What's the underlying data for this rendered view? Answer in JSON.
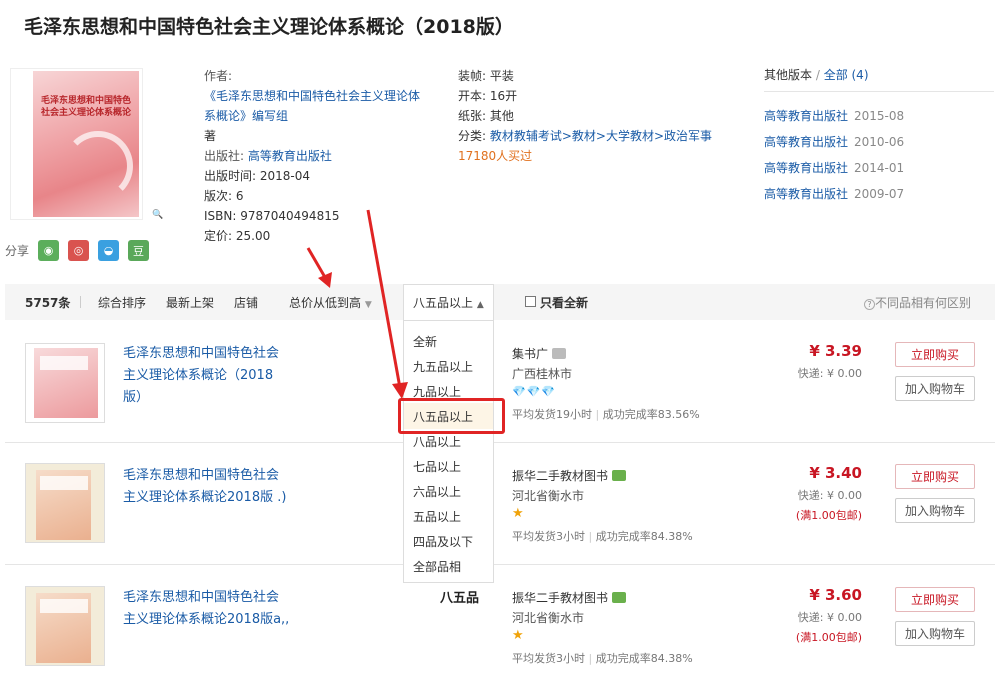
{
  "title": "毛泽东思想和中国特色社会主义理论体系概论（2018版）",
  "cover_text": "毛泽东思想和中国特色社会主义理论体系概论",
  "share": {
    "label": "分享",
    "buttons": [
      "wechat",
      "weibo",
      "qq",
      "douban"
    ],
    "douban_label": "豆"
  },
  "book_info": {
    "author_label": "作者:",
    "author_line1": "《毛泽东思想和中国特色社会主义理论体",
    "author_line2": "系概论》编写组",
    "author_suffix": "著",
    "publisher_label": "出版社: ",
    "publisher": "高等教育出版社",
    "pubdate": "出版时间: 2018-04",
    "edition": "版次: 6",
    "isbn": "ISBN: 9787040494815",
    "price": "定价: 25.00",
    "binding": "装帧: 平装",
    "format": "开本: 16开",
    "paper": "纸张: 其他",
    "category_label": "分类: ",
    "category": "教材教辅考试>教材>大学教材>政治军事",
    "buyers": "17180人买过"
  },
  "versions": {
    "title": "其他版本",
    "sep": " / ",
    "all": "全部 (4)",
    "items": [
      {
        "publisher": "高等教育出版社",
        "date": "2015-08"
      },
      {
        "publisher": "高等教育出版社",
        "date": "2010-06"
      },
      {
        "publisher": "高等教育出版社",
        "date": "2014-01"
      },
      {
        "publisher": "高等教育出版社",
        "date": "2009-07"
      }
    ]
  },
  "filter": {
    "count": "5757条",
    "sort_default": "综合排序",
    "sort_new": "最新上架",
    "sort_shop": "店铺",
    "sort_price": "总价从低到高",
    "quality_selected": "八五品以上",
    "only_new": "只看全新",
    "help": "不同品相有何区别"
  },
  "quality_options": [
    "全新",
    "九五品以上",
    "九品以上",
    "八五品以上",
    "八品以上",
    "七品以上",
    "六品以上",
    "五品以上",
    "四品及以下",
    "全部品相"
  ],
  "listings": [
    {
      "title_lines": [
        "毛泽东思想和中国特色社会",
        "主义理论体系概论（2018",
        "版）"
      ],
      "condition": "",
      "shop": "集书广",
      "location": "广西桂林市",
      "rating": "💎💎💎",
      "dispatch": "平均发货19小时",
      "success": "成功完成率83.56%",
      "price": "¥ 3.39",
      "shipping": "快递: ¥ 0.00",
      "free_note": "",
      "buy_label": "立即购买",
      "cart_label": "加入购物车"
    },
    {
      "title_lines": [
        "毛泽东思想和中国特色社会",
        "主义理论体系概论2018版 .)"
      ],
      "condition": "",
      "shop": "振华二手教材图书",
      "location": "河北省衡水市",
      "rating": "★",
      "dispatch": "平均发货3小时",
      "success": "成功完成率84.38%",
      "price": "¥ 3.40",
      "shipping": "快递: ¥ 0.00",
      "free_note": "(满1.00包邮)",
      "buy_label": "立即购买",
      "cart_label": "加入购物车"
    },
    {
      "title_lines": [
        "毛泽东思想和中国特色社会",
        "主义理论体系概论2018版a,,"
      ],
      "condition": "八五品",
      "shop": "振华二手教材图书",
      "location": "河北省衡水市",
      "rating": "★",
      "dispatch": "平均发货3小时",
      "success": "成功完成率84.38%",
      "price": "¥ 3.60",
      "shipping": "快递: ¥ 0.00",
      "free_note": "(满1.00包邮)",
      "buy_label": "立即购买",
      "cart_label": "加入购物车"
    }
  ],
  "colors": {
    "price": "#c81623",
    "link": "#1a5ba6",
    "highlight": "#e02424",
    "orange": "#e0711f"
  }
}
